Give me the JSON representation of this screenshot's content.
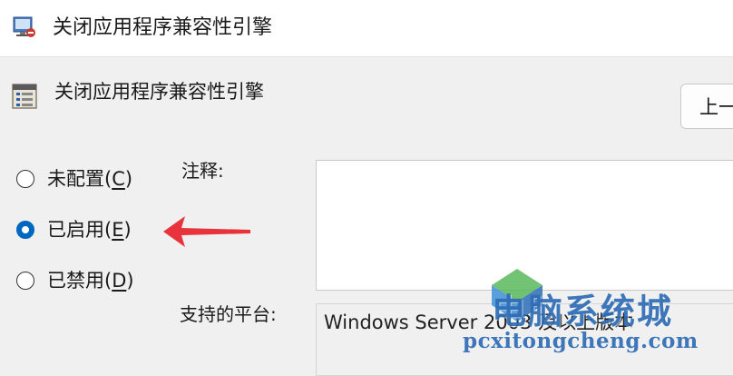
{
  "window": {
    "title": "关闭应用程序兼容性引擎"
  },
  "header": {
    "setting_title": "关闭应用程序兼容性引擎",
    "prev_button_label": "上一"
  },
  "state_options": [
    {
      "label": "未配置",
      "accel": "C",
      "checked": false
    },
    {
      "label": "已启用",
      "accel": "E",
      "checked": true
    },
    {
      "label": "已禁用",
      "accel": "D",
      "checked": false
    }
  ],
  "comment": {
    "label": "注释:",
    "value": ""
  },
  "supported_platforms": {
    "label": "支持的平台:",
    "value": "Windows Server 2003 及以上版本"
  },
  "watermark": {
    "text_cn": "电脑系统城",
    "url": "pcxitongcheng.com"
  },
  "colors": {
    "accent": "#0067c0",
    "arrow": "#e8323c",
    "watermark": "#2f6db5"
  }
}
